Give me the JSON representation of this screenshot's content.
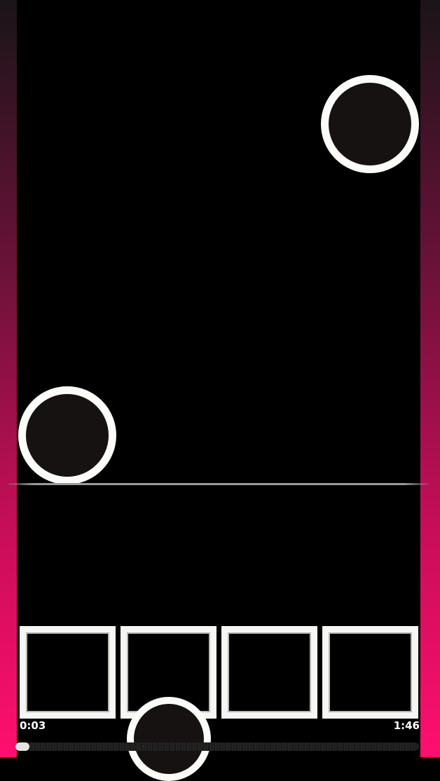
{
  "theme": {
    "gradient_top": "#1a1418",
    "gradient_bottom": "#ff0f6e",
    "note_ring": "#fbfbf8",
    "note_fill": "#171212"
  },
  "hud": {
    "time_elapsed": "0:03",
    "time_total": "1:46",
    "progress_fraction": 0.035
  },
  "lanes": [
    {
      "key": 1
    },
    {
      "key": 2
    },
    {
      "key": 3
    },
    {
      "key": 4
    }
  ]
}
